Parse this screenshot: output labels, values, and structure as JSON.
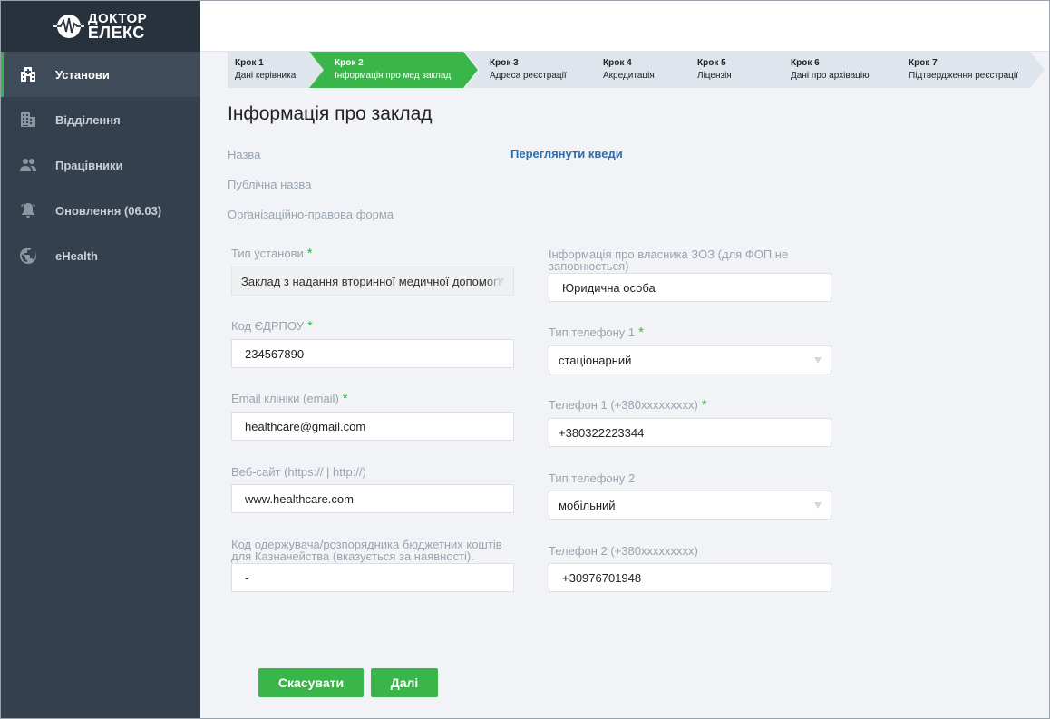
{
  "brand": {
    "line1": "ДОКТОР",
    "line2": "ЕЛЕКС"
  },
  "sidebar": {
    "items": [
      {
        "label": "Установи",
        "icon": "hospital-icon"
      },
      {
        "label": "Відділення",
        "icon": "building-icon"
      },
      {
        "label": "Працівники",
        "icon": "people-icon"
      },
      {
        "label": "Оновлення (06.03)",
        "icon": "bell-icon"
      },
      {
        "label": "eHealth",
        "icon": "globe-icon"
      }
    ]
  },
  "stepper": {
    "steps": [
      {
        "num": "Крок 1",
        "label": "Дані керівника"
      },
      {
        "num": "Крок 2",
        "label": "Інформація про мед заклад"
      },
      {
        "num": "Крок 3",
        "label": "Адреса реєстрації"
      },
      {
        "num": "Крок 4",
        "label": "Акредитація"
      },
      {
        "num": "Крок 5",
        "label": "Ліцензія"
      },
      {
        "num": "Крок 6",
        "label": "Дані про архівацію"
      },
      {
        "num": "Крок 7",
        "label": "Підтвердження реєстрації"
      }
    ],
    "colors": {
      "active": "#39b54a",
      "inactive": "#dfe5ec"
    }
  },
  "page": {
    "title": "Інформація про заклад",
    "name_label": "Назва",
    "public_name_label": "Публічна назва",
    "legal_form_label": "Організаційно-правова форма",
    "kved_link": "Переглянути кведи"
  },
  "form": {
    "facility_type": {
      "label": "Тип установи",
      "value": "Заклад з надання вторинної медичної допомоги"
    },
    "edrpou": {
      "label": "Код ЄДРПОУ",
      "value": "234567890"
    },
    "email": {
      "label": "Email клініки (email)",
      "value": "healthcare@gmail.com"
    },
    "website": {
      "label": "Веб-сайт (https:// | http://)",
      "value": "www.healthcare.com"
    },
    "treasury_code": {
      "label": "Код одержувача/розпорядника бюджетних коштів для Казначейства (вказується за наявності).",
      "value": "-"
    },
    "owner_info": {
      "label": "Інформація про власника ЗОЗ (для ФОП не заповнюється)",
      "value": "Юридична особа"
    },
    "phone_type_1": {
      "label": "Тип телефону 1",
      "value": "стаціонарний"
    },
    "phone_1": {
      "label": "Телефон 1 (+380xxxxxxxxx)",
      "value": "+380322223344"
    },
    "phone_type_2": {
      "label": "Тип телефону 2",
      "value": "мобільний"
    },
    "phone_2": {
      "label": "Телефон 2 (+380xxxxxxxxx)",
      "value": "+30976701948"
    }
  },
  "actions": {
    "cancel": "Скасувати",
    "next": "Далі"
  }
}
